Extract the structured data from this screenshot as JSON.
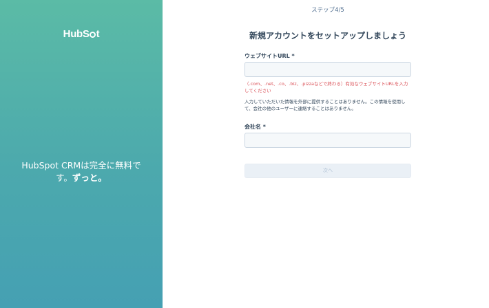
{
  "left_panel": {
    "logo_parts": [
      "HubS",
      "p",
      "t"
    ],
    "tagline_line1": "HubSpot CRMは完全に無料で",
    "tagline_line2_prefix": "す。",
    "tagline_line2_bold": "ずっと。"
  },
  "form": {
    "step": "ステップ4/5",
    "heading": "新規アカウントをセットアップしましょう",
    "website_label": "ウェブサイトURL *",
    "website_value": "",
    "website_error": "（.com、.net、.co、.biz、.pizzaなどで終わる）有効なウェブサイトURLを入力してください",
    "help_text": "入力していただいた情報を外部に提供することはありません。この情報を使用して、会社の他のユーザーに連絡することはありません。",
    "company_label": "会社名 *",
    "company_value": "",
    "next_button": "次へ"
  },
  "colors": {
    "gradient_top": "#5bbba6",
    "gradient_bottom": "#45a0b3",
    "error": "#d94c53",
    "text": "#33475b"
  }
}
